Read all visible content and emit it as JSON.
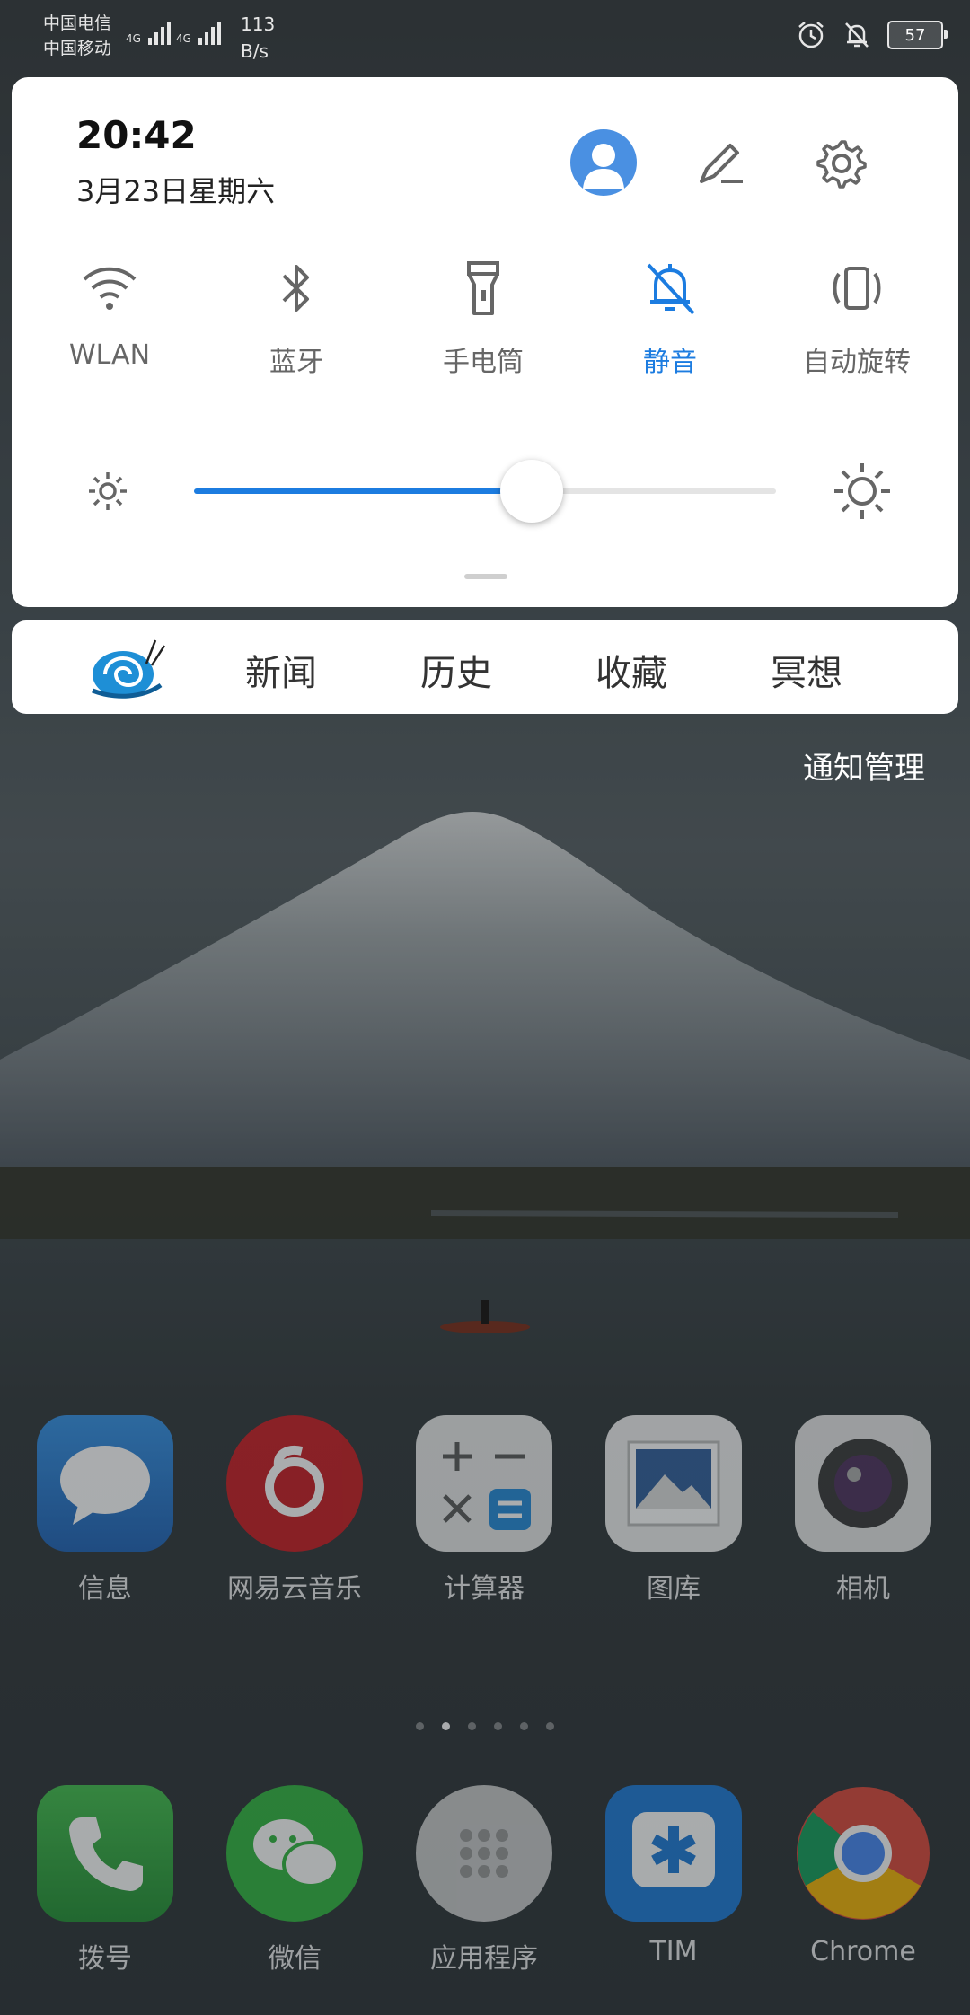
{
  "status_bar": {
    "carrier_1": "中国电信",
    "carrier_2": "中国移动",
    "net_type_1": "4G",
    "net_type_2": "4G",
    "speed_value": "113",
    "speed_unit": "B/s",
    "battery": "57",
    "icons": [
      "alarm-icon",
      "mute-bell-icon",
      "battery-icon"
    ]
  },
  "panel": {
    "time": "20:42",
    "date": "3月23日星期六",
    "header_icons": [
      "avatar-icon",
      "edit-pencil-icon",
      "settings-gear-icon"
    ],
    "tiles": [
      {
        "label": "WLAN",
        "icon": "wifi-icon",
        "active": false
      },
      {
        "label": "蓝牙",
        "icon": "bluetooth-icon",
        "active": false
      },
      {
        "label": "手电筒",
        "icon": "flashlight-icon",
        "active": false
      },
      {
        "label": "静音",
        "icon": "mute-bell-icon",
        "active": true
      },
      {
        "label": "自动旋转",
        "icon": "auto-rotate-icon",
        "active": false
      }
    ],
    "brightness": {
      "value": 0.58,
      "accent": "#1c7ce0"
    }
  },
  "news_bar": {
    "logo_icon": "snail-logo-icon",
    "items": [
      "新闻",
      "历史",
      "收藏",
      "冥想"
    ]
  },
  "notification_management": "通知管理",
  "home_row_1": [
    {
      "name": "信息",
      "icon": "messages-icon"
    },
    {
      "name": "网易云音乐",
      "icon": "netease-music-icon"
    },
    {
      "name": "计算器",
      "icon": "calculator-icon"
    },
    {
      "name": "图库",
      "icon": "gallery-icon"
    },
    {
      "name": "相机",
      "icon": "camera-icon"
    }
  ],
  "dock": [
    {
      "name": "拨号",
      "icon": "phone-icon"
    },
    {
      "name": "微信",
      "icon": "wechat-icon"
    },
    {
      "name": "应用程序",
      "icon": "app-drawer-icon"
    },
    {
      "name": "TIM",
      "icon": "tim-icon"
    },
    {
      "name": "Chrome",
      "icon": "chrome-icon"
    }
  ]
}
